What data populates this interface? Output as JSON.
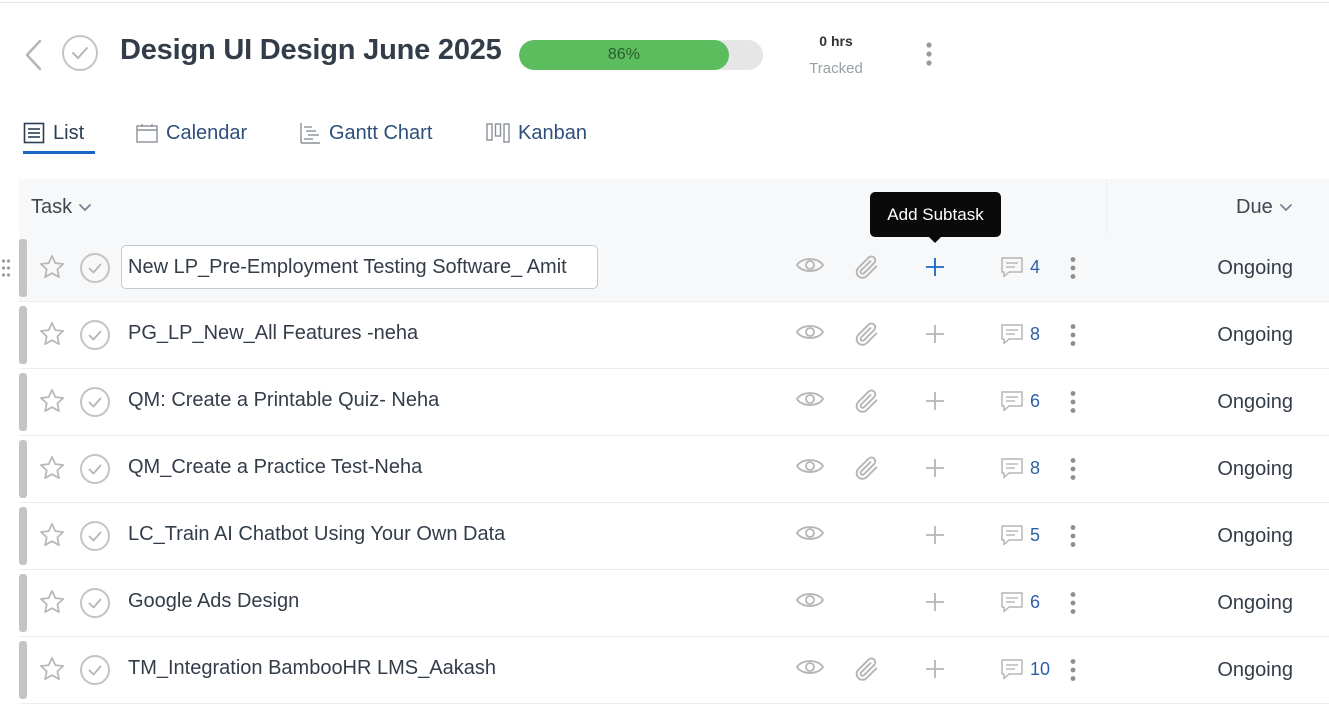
{
  "header": {
    "title": "Design UI Design June 2025",
    "progress_percent": 86,
    "progress_label": "86%",
    "tracked_hours": "0 hrs",
    "tracked_label": "Tracked"
  },
  "views": {
    "tabs": [
      {
        "label": "List",
        "icon": "list-icon",
        "active": true
      },
      {
        "label": "Calendar",
        "icon": "calendar-icon",
        "active": false
      },
      {
        "label": "Gantt Chart",
        "icon": "gantt-icon",
        "active": false
      },
      {
        "label": "Kanban",
        "icon": "kanban-icon",
        "active": false
      }
    ]
  },
  "table": {
    "columns": {
      "task": "Task",
      "due": "Due"
    },
    "tooltip": "Add Subtask",
    "rows": [
      {
        "name": "New LP_Pre-Employment Testing Software_ Amit",
        "attachments": true,
        "comments": "4",
        "due": "Ongoing",
        "editing": true
      },
      {
        "name": "PG_LP_New_All Features -neha",
        "attachments": true,
        "comments": "8",
        "due": "Ongoing"
      },
      {
        "name": "QM: Create a Printable Quiz- Neha",
        "attachments": true,
        "comments": "6",
        "due": "Ongoing"
      },
      {
        "name": "QM_Create a Practice Test-Neha",
        "attachments": true,
        "comments": "8",
        "due": "Ongoing"
      },
      {
        "name": "LC_Train AI Chatbot Using Your Own Data",
        "attachments": false,
        "comments": "5",
        "due": "Ongoing"
      },
      {
        "name": "Google Ads Design",
        "attachments": false,
        "comments": "6",
        "due": "Ongoing"
      },
      {
        "name": "TM_Integration BambooHR LMS_Aakash",
        "attachments": true,
        "comments": "10",
        "due": "Ongoing"
      }
    ]
  },
  "colors": {
    "progress": "#5cbd5f",
    "accent": "#1a66c2",
    "link": "#2d5fa6"
  }
}
